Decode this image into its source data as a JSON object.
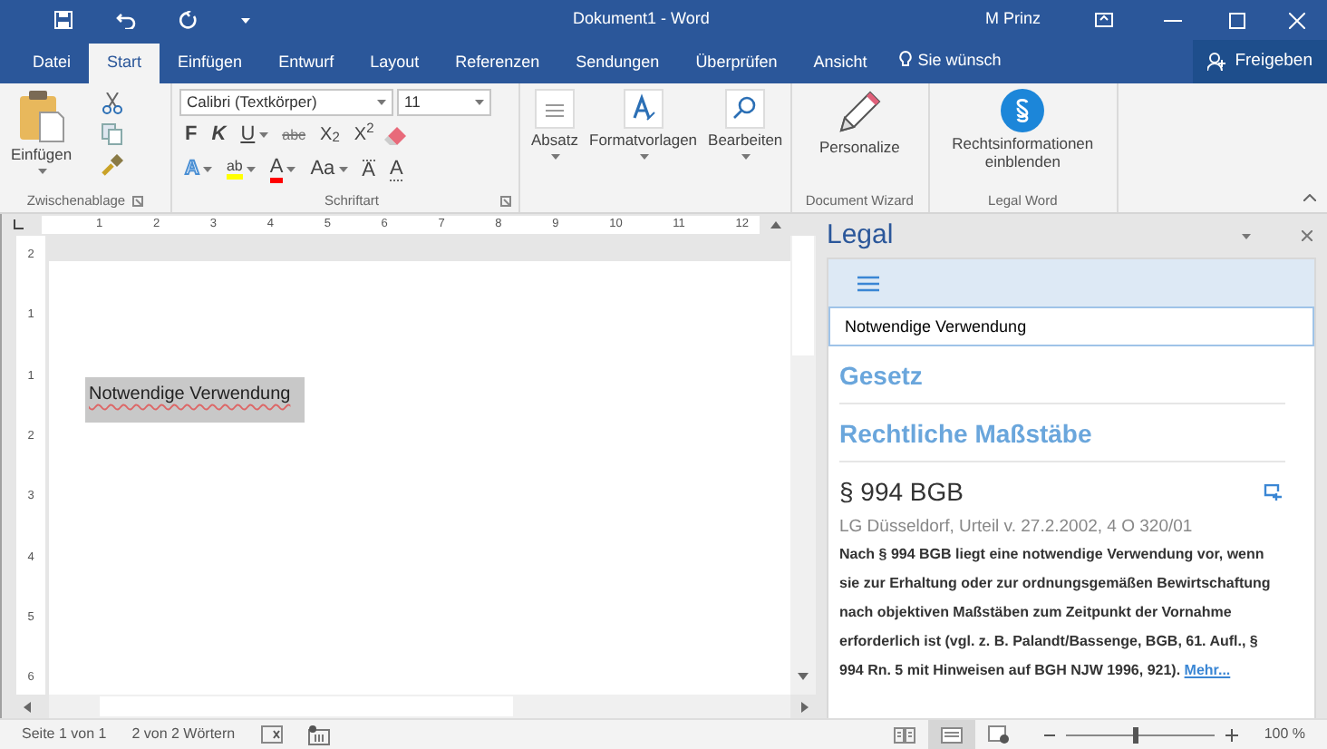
{
  "title_bar": {
    "title": "Dokument1  -  Word",
    "user": "M Prinz"
  },
  "tabs": [
    {
      "label": "Datei",
      "selected": false
    },
    {
      "label": "Start",
      "selected": true
    },
    {
      "label": "Einfügen",
      "selected": false
    },
    {
      "label": "Entwurf",
      "selected": false
    },
    {
      "label": "Layout",
      "selected": false
    },
    {
      "label": "Referenzen",
      "selected": false
    },
    {
      "label": "Sendungen",
      "selected": false
    },
    {
      "label": "Überprüfen",
      "selected": false
    },
    {
      "label": "Ansicht",
      "selected": false
    }
  ],
  "tell_me": "Sie wünsch",
  "share_button": "Freigeben",
  "clipboard": {
    "paste": "Einfügen",
    "group": "Zwischenablage"
  },
  "font": {
    "name": "Calibri (Textkörper)",
    "size": "11",
    "group": "Schriftart",
    "row_1": [
      {
        "kind": "bold",
        "label": "F",
        "dropdown": false
      },
      {
        "kind": "italic",
        "label": "K",
        "dropdown": false
      },
      {
        "kind": "underline",
        "label": "U",
        "dropdown": true
      },
      {
        "kind": "strikethrough",
        "label": "abc",
        "dropdown": false
      },
      {
        "kind": "subscript",
        "label": "X$_{2}$",
        "dropdown": false
      },
      {
        "kind": "superscript",
        "label": "X$^{2}$",
        "dropdown": false
      }
    ],
    "row_2": [
      {
        "kind": "effects",
        "label": "A",
        "dropdown": true
      },
      {
        "kind": "highlight",
        "label": "ab",
        "color": "#ffff00",
        "dropdown": true
      },
      {
        "kind": "color",
        "label": "A",
        "color": "#ff0000",
        "dropdown": true
      },
      {
        "kind": "case",
        "label": "Aa",
        "dropdown": true
      },
      {
        "kind": "grow",
        "label": "A",
        "dropdown": false
      },
      {
        "kind": "shrink",
        "label": "A",
        "dropdown": false
      }
    ]
  },
  "paragraph": "Absatz",
  "styles": "Formatvorlagen",
  "editing": "Bearbeiten",
  "wizard": {
    "button": "Personalize",
    "group": "Document Wizard"
  },
  "legal_word": {
    "button": "Rechtsinformationen einblenden",
    "group": "Legal Word"
  },
  "ruler": {
    "horizontal": [
      "1",
      "2",
      "3",
      "4",
      "5",
      "6",
      "7",
      "8",
      "9",
      "10",
      "11",
      "12"
    ],
    "vertical": [
      "2",
      "1",
      "1",
      "2",
      "3",
      "4",
      "5",
      "6"
    ]
  },
  "document": {
    "text": "Notwendige Verwendung",
    "selected": true
  },
  "legal_pane": {
    "title": "Legal",
    "search_value": "Notwendige Verwendung",
    "sections": [
      "Gesetz",
      "Rechtliche Maßstäbe"
    ],
    "results": [
      {
        "heading": "§ 994 BGB",
        "source": "LG Düsseldorf, Urteil v. 27.2.2002, 4 O 320/01",
        "excerpt": "Nach § 994 BGB liegt eine notwendige Verwendung vor, wenn sie zur Erhaltung oder zur ordnungsgemäßen Bewirtschaftung nach objektiven Maßstäben zum Zeitpunkt der Vornahme erforderlich ist (vgl. z. B. Palandt/Bassenge, BGB, 61. Aufl., § 994 Rn. 5 mit Hinweisen auf BGH NJW 1996, 921).",
        "more": "Mehr..."
      }
    ]
  },
  "status_bar": {
    "page": "Seite 1 von 1",
    "words": "2 von 2 Wörtern",
    "views": [
      {
        "kind": "read",
        "selected": false
      },
      {
        "kind": "print",
        "selected": true
      },
      {
        "kind": "web",
        "selected": false
      }
    ],
    "zoom": {
      "level": 0.47,
      "reading": "100 %"
    }
  }
}
